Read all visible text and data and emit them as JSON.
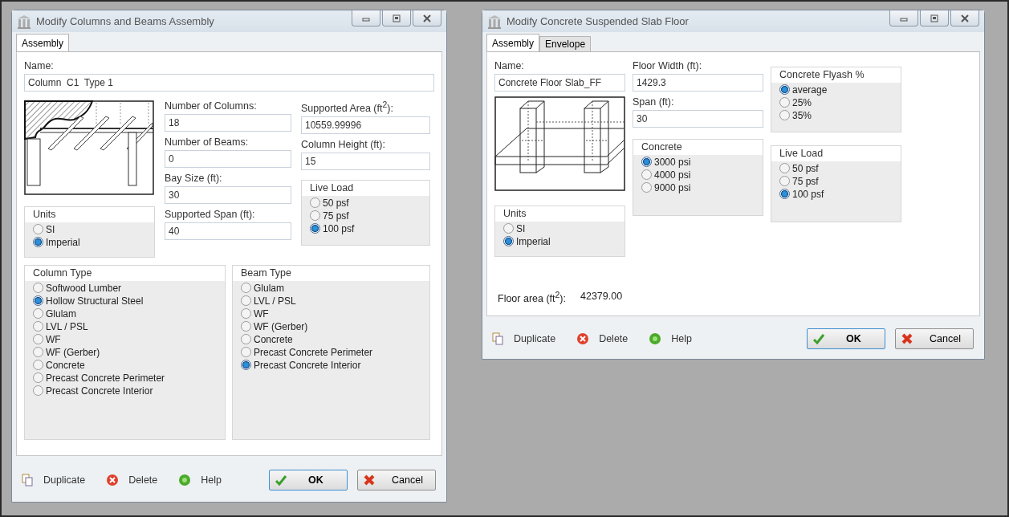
{
  "dialogs": [
    {
      "kind": "columns_beams",
      "title": "Modify  Columns and Beams Assembly",
      "tabs": [
        {
          "label": "Assembly",
          "selected": true
        }
      ],
      "name_field": {
        "label": "Name:",
        "value": "Column  C1  Type 1"
      },
      "fields_1": [
        {
          "label": "Number of Columns:",
          "value": "18"
        },
        {
          "label": "Number of Beams:",
          "value": "0"
        },
        {
          "label": "Bay Size (ft):",
          "value": "30"
        },
        {
          "label": "Supported Span (ft):",
          "value": "40"
        }
      ],
      "fields_2": [
        {
          "label": "Supported Area (ft$^{2}$):",
          "value": "10559.99996"
        },
        {
          "label": "Column Height (ft):",
          "value": "15"
        }
      ],
      "live_load": {
        "label": "Live Load",
        "options": [
          {
            "label": "50 psf",
            "selected": false
          },
          {
            "label": "75 psf",
            "selected": false
          },
          {
            "label": "100 psf",
            "selected": true
          }
        ]
      },
      "units": {
        "label": "Units",
        "options": [
          {
            "label": "SI",
            "selected": false
          },
          {
            "label": "Imperial",
            "selected": true
          }
        ]
      },
      "column_type": {
        "label": "Column Type",
        "options": [
          {
            "label": "Softwood Lumber",
            "selected": false
          },
          {
            "label": "Hollow Structural Steel",
            "selected": true
          },
          {
            "label": "Glulam",
            "selected": false
          },
          {
            "label": "LVL / PSL",
            "selected": false
          },
          {
            "label": "WF",
            "selected": false
          },
          {
            "label": "WF (Gerber)",
            "selected": false
          },
          {
            "label": "Concrete",
            "selected": false
          },
          {
            "label": "Precast Concrete Perimeter",
            "selected": false
          },
          {
            "label": "Precast Concrete Interior",
            "selected": false
          }
        ]
      },
      "beam_type": {
        "label": "Beam Type",
        "options": [
          {
            "label": "Glulam",
            "selected": false
          },
          {
            "label": "LVL / PSL",
            "selected": false
          },
          {
            "label": "WF",
            "selected": false
          },
          {
            "label": "WF (Gerber)",
            "selected": false
          },
          {
            "label": "Concrete",
            "selected": false
          },
          {
            "label": "Precast Concrete Perimeter",
            "selected": false
          },
          {
            "label": "Precast Concrete Interior",
            "selected": true
          }
        ]
      },
      "actions": [
        {
          "kind": "duplicate",
          "label": "Duplicate"
        },
        {
          "kind": "delete",
          "label": "Delete"
        },
        {
          "kind": "help",
          "label": "Help"
        }
      ],
      "buttons": [
        {
          "kind": "ok",
          "label": "OK"
        },
        {
          "kind": "cancel",
          "label": "Cancel"
        }
      ]
    },
    {
      "kind": "slab",
      "title": "Modify Concrete Suspended Slab Floor",
      "tabs": [
        {
          "label": "Assembly",
          "selected": true
        },
        {
          "label": "Envelope",
          "selected": false
        }
      ],
      "name_field": {
        "label": "Name:",
        "value": "Concrete Floor Slab_FF"
      },
      "fields_1": [
        {
          "label": "Floor Width (ft):",
          "value": "1429.3"
        },
        {
          "label": "Span (ft):",
          "value": "30"
        }
      ],
      "concrete": {
        "label": "Concrete",
        "options": [
          {
            "label": "3000 psi",
            "selected": true
          },
          {
            "label": "4000 psi",
            "selected": false
          },
          {
            "label": "9000 psi",
            "selected": false
          }
        ]
      },
      "flyash": {
        "label": "Concrete Flyash %",
        "options": [
          {
            "label": "average",
            "selected": true
          },
          {
            "label": "25%",
            "selected": false
          },
          {
            "label": "35%",
            "selected": false
          }
        ]
      },
      "live_load": {
        "label": "Live Load",
        "options": [
          {
            "label": "50 psf",
            "selected": false
          },
          {
            "label": "75 psf",
            "selected": false
          },
          {
            "label": "100 psf",
            "selected": true
          }
        ]
      },
      "units": {
        "label": "Units",
        "options": [
          {
            "label": "SI",
            "selected": false
          },
          {
            "label": "Imperial",
            "selected": true
          }
        ]
      },
      "floor_area": {
        "label": "Floor area (ft$^{2}$):",
        "value": "42379.00"
      },
      "actions": [
        {
          "kind": "duplicate",
          "label": "Duplicate"
        },
        {
          "kind": "delete",
          "label": "Delete"
        },
        {
          "kind": "help",
          "label": "Help"
        }
      ],
      "buttons": [
        {
          "kind": "ok",
          "label": "OK"
        },
        {
          "kind": "cancel",
          "label": "Cancel"
        }
      ]
    }
  ]
}
